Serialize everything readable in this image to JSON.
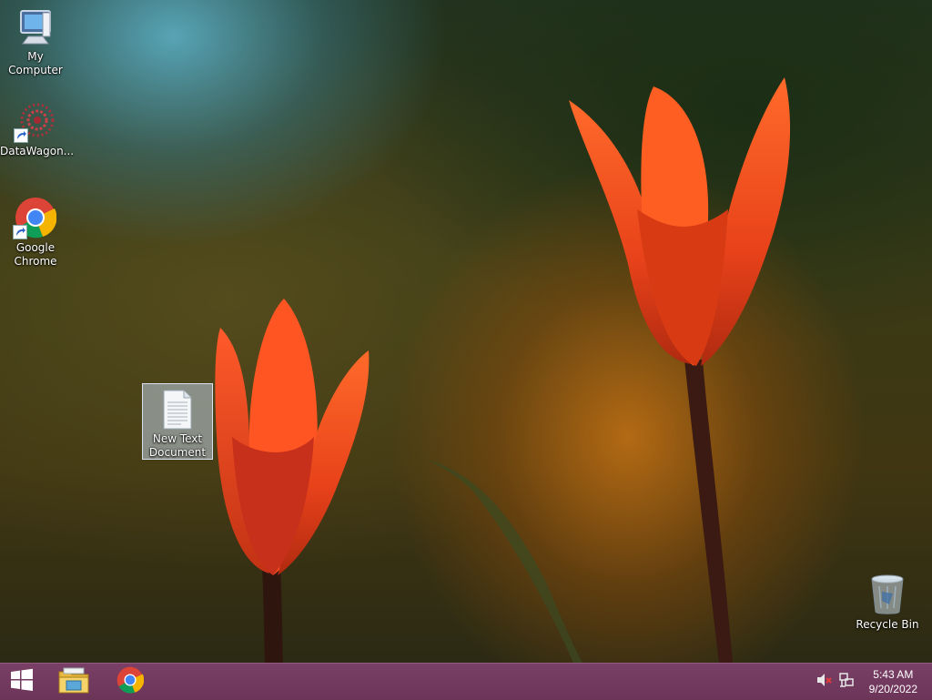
{
  "desktop": {
    "icons": [
      {
        "label": "My Computer"
      },
      {
        "label": "DataWagon..."
      },
      {
        "label": "Google Chrome"
      },
      {
        "label": "New Text Document"
      },
      {
        "label": "Recycle Bin"
      }
    ]
  },
  "taskbar": {
    "start_icon": "windows-logo-icon",
    "pinned": [
      "file-explorer-icon",
      "google-chrome-icon"
    ],
    "tray": [
      "volume-muted-icon",
      "network-icon"
    ],
    "clock": {
      "time": "5:43 AM",
      "date": "9/20/2022"
    }
  },
  "colors": {
    "taskbar": "#6f385c",
    "selection": "#bfcde0"
  }
}
